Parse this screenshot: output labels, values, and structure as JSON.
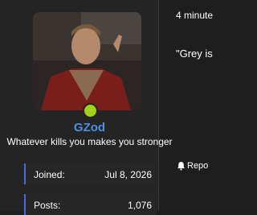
{
  "user": {
    "username": "GZod",
    "tagline": "Whatever kills you makes you stronger",
    "status": "online",
    "status_color": "#a3d117",
    "username_color": "#4a90e2"
  },
  "stats": [
    {
      "label": "Joined:",
      "value": "Jul 8, 2026"
    },
    {
      "label": "Posts:",
      "value": "1,076"
    }
  ],
  "post": {
    "timestamp": "4 minute",
    "body": "\"Grey is",
    "report_label": "Repo"
  },
  "colors": {
    "stat_accent": "#4a6bd6",
    "background": "#1e1e1e"
  }
}
